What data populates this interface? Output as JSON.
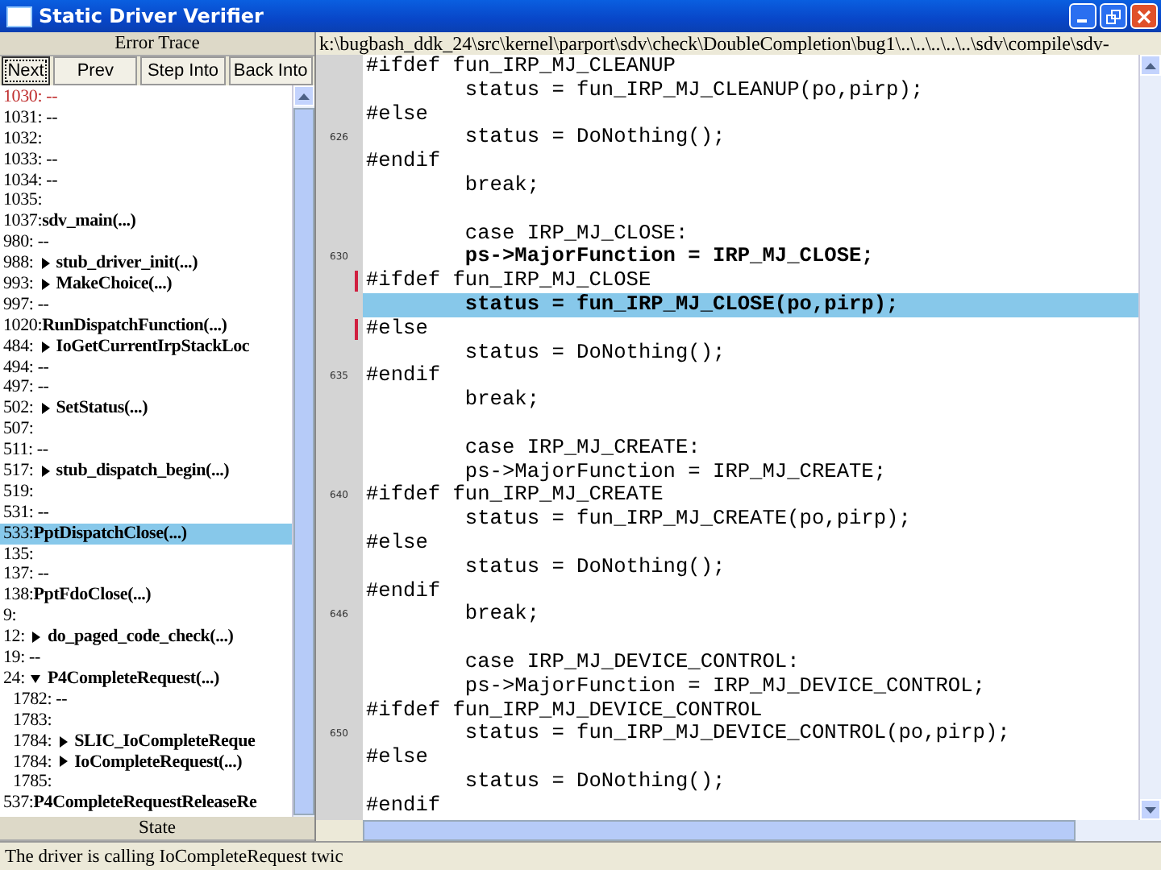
{
  "window": {
    "title": "Static Driver Verifier"
  },
  "trace_panel": {
    "title": "Error Trace",
    "buttons": [
      {
        "label": "Next",
        "focused": true
      },
      {
        "label": "Prev",
        "focused": false
      },
      {
        "label": "Step Into",
        "focused": false
      },
      {
        "label": "Back Into",
        "focused": false
      }
    ],
    "items": [
      {
        "line": "1030:",
        "text": "--",
        "flagged": true,
        "selected": false
      },
      {
        "line": "1031:",
        "text": "--",
        "flagged": false,
        "selected": false
      },
      {
        "line": "1032:",
        "flagged": false,
        "selected": false
      },
      {
        "line": "1033:",
        "text": "--",
        "flagged": false,
        "selected": false
      },
      {
        "line": "1034:",
        "text": "--",
        "flagged": false,
        "selected": false
      },
      {
        "line": "1035:",
        "flagged": false,
        "selected": false
      },
      {
        "line": "1037:",
        "call": "sdv_main(...)",
        "flagged": false,
        "selected": false
      },
      {
        "line": "980:",
        "text": "--",
        "flagged": false,
        "selected": false
      },
      {
        "line": "988:",
        "call": "stub_driver_init(...)",
        "expanded": false,
        "flagged": false,
        "selected": false
      },
      {
        "line": "993:",
        "call": "MakeChoice(...)",
        "expanded": false,
        "flagged": false,
        "selected": false
      },
      {
        "line": "997:",
        "text": "--",
        "flagged": false,
        "selected": false
      },
      {
        "line": "1020:",
        "call": "RunDispatchFunction(...)",
        "flagged": false,
        "selected": false
      },
      {
        "line": "484:",
        "call": "IoGetCurrentIrpStackLoc",
        "expanded": false,
        "flagged": false,
        "selected": false
      },
      {
        "line": "494:",
        "text": "--",
        "flagged": false,
        "selected": false
      },
      {
        "line": "497:",
        "text": "--",
        "flagged": false,
        "selected": false
      },
      {
        "line": "502:",
        "call": "SetStatus(...)",
        "expanded": false,
        "flagged": false,
        "selected": false
      },
      {
        "line": "507:",
        "flagged": false,
        "selected": false
      },
      {
        "line": "511:",
        "text": "--",
        "flagged": false,
        "selected": false
      },
      {
        "line": "517:",
        "call": "stub_dispatch_begin(...)",
        "expanded": false,
        "flagged": false,
        "selected": false
      },
      {
        "line": "519:",
        "flagged": false,
        "selected": false
      },
      {
        "line": "531:",
        "text": "--",
        "flagged": false,
        "selected": false
      },
      {
        "line": "533:",
        "call": "PptDispatchClose(...)",
        "flagged": false,
        "selected": true
      },
      {
        "line": "135:",
        "flagged": false,
        "selected": false
      },
      {
        "line": "137:",
        "text": "--",
        "flagged": false,
        "selected": false
      },
      {
        "line": "138:",
        "call": "PptFdoClose(...)",
        "flagged": false,
        "selected": false
      },
      {
        "line": "9:",
        "flagged": false,
        "selected": false
      },
      {
        "line": "12:",
        "call": "do_paged_code_check(...)",
        "expanded": false,
        "flagged": false,
        "selected": false
      },
      {
        "line": "19:",
        "text": "--",
        "flagged": false,
        "selected": false
      },
      {
        "line": "24:",
        "call": "P4CompleteRequest(...)",
        "expanded": true,
        "flagged": false,
        "selected": false,
        "children": [
          {
            "line": "1782:",
            "text": "--",
            "flagged": false,
            "selected": false
          },
          {
            "line": "1783:",
            "flagged": false,
            "selected": false
          },
          {
            "line": "1784:",
            "call": "SLIC_IoCompleteReque",
            "expanded": false,
            "flagged": false,
            "selected": false
          },
          {
            "line": "1784:",
            "call": "IoCompleteRequest(...)",
            "expanded": false,
            "flagged": false,
            "selected": false
          },
          {
            "line": "1785:",
            "flagged": false,
            "selected": false
          }
        ]
      },
      {
        "line": "537:",
        "call": "P4CompleteRequestReleaseRe",
        "flagged": false,
        "selected": false
      }
    ],
    "state_title": "State"
  },
  "editor": {
    "path": "k:\\bugbash_ddk_24\\src\\kernel\\parport\\sdv\\check\\DoubleCompletion\\bug1\\..\\..\\..\\..\\..\\sdv\\compile\\sdv-",
    "lines": [
      {
        "text": "#ifdef fun_IRP_MJ_CLEANUP",
        "bold": false,
        "selected": false,
        "marked": false
      },
      {
        "text": "        status = fun_IRP_MJ_CLEANUP(po,pirp);",
        "bold": false,
        "selected": false,
        "marked": false
      },
      {
        "text": "#else",
        "bold": false,
        "selected": false,
        "marked": false
      },
      {
        "number": "626",
        "text": "        status = DoNothing();",
        "bold": false,
        "selected": false,
        "marked": false
      },
      {
        "text": "#endif",
        "bold": false,
        "selected": false,
        "marked": false
      },
      {
        "text": "        break;",
        "bold": false,
        "selected": false,
        "marked": false
      },
      {
        "selected": false,
        "marked": false
      },
      {
        "text": "        case IRP_MJ_CLOSE:",
        "bold": false,
        "selected": false,
        "marked": false
      },
      {
        "number": "630",
        "text": "        ps->MajorFunction = IRP_MJ_CLOSE;",
        "bold": true,
        "selected": false,
        "marked": false
      },
      {
        "text": "#ifdef fun_IRP_MJ_CLOSE",
        "bold": false,
        "selected": false,
        "marked": true
      },
      {
        "text": "        status = fun_IRP_MJ_CLOSE(po,pirp);",
        "bold": true,
        "selected": true,
        "marked": false
      },
      {
        "text": "#else",
        "bold": false,
        "selected": false,
        "marked": true
      },
      {
        "text": "        status = DoNothing();",
        "bold": false,
        "selected": false,
        "marked": false
      },
      {
        "number": "635",
        "text": "#endif",
        "bold": false,
        "selected": false,
        "marked": false
      },
      {
        "text": "        break;",
        "bold": false,
        "selected": false,
        "marked": false
      },
      {
        "selected": false,
        "marked": false
      },
      {
        "text": "        case IRP_MJ_CREATE:",
        "bold": false,
        "selected": false,
        "marked": false
      },
      {
        "text": "        ps->MajorFunction = IRP_MJ_CREATE;",
        "bold": false,
        "selected": false,
        "marked": false
      },
      {
        "number": "640",
        "text": "#ifdef fun_IRP_MJ_CREATE",
        "bold": false,
        "selected": false,
        "marked": false
      },
      {
        "text": "        status = fun_IRP_MJ_CREATE(po,pirp);",
        "bold": false,
        "selected": false,
        "marked": false
      },
      {
        "text": "#else",
        "bold": false,
        "selected": false,
        "marked": false
      },
      {
        "text": "        status = DoNothing();",
        "bold": false,
        "selected": false,
        "marked": false
      },
      {
        "text": "#endif",
        "bold": false,
        "selected": false,
        "marked": false
      },
      {
        "number": "646",
        "text": "        break;",
        "bold": false,
        "selected": false,
        "marked": false
      },
      {
        "selected": false,
        "marked": false
      },
      {
        "text": "        case IRP_MJ_DEVICE_CONTROL:",
        "bold": false,
        "selected": false,
        "marked": false
      },
      {
        "text": "        ps->MajorFunction = IRP_MJ_DEVICE_CONTROL;",
        "bold": false,
        "selected": false,
        "marked": false
      },
      {
        "text": "#ifdef fun_IRP_MJ_DEVICE_CONTROL",
        "bold": false,
        "selected": false,
        "marked": false
      },
      {
        "number": "650",
        "text": "        status = fun_IRP_MJ_DEVICE_CONTROL(po,pirp);",
        "bold": false,
        "selected": false,
        "marked": false
      },
      {
        "text": "#else",
        "bold": false,
        "selected": false,
        "marked": false
      },
      {
        "text": "        status = DoNothing();",
        "bold": false,
        "selected": false,
        "marked": false
      },
      {
        "text": "#endif",
        "bold": false,
        "selected": false,
        "marked": false
      }
    ]
  },
  "status_bar": {
    "text": "The driver is calling IoCompleteRequest twic"
  }
}
